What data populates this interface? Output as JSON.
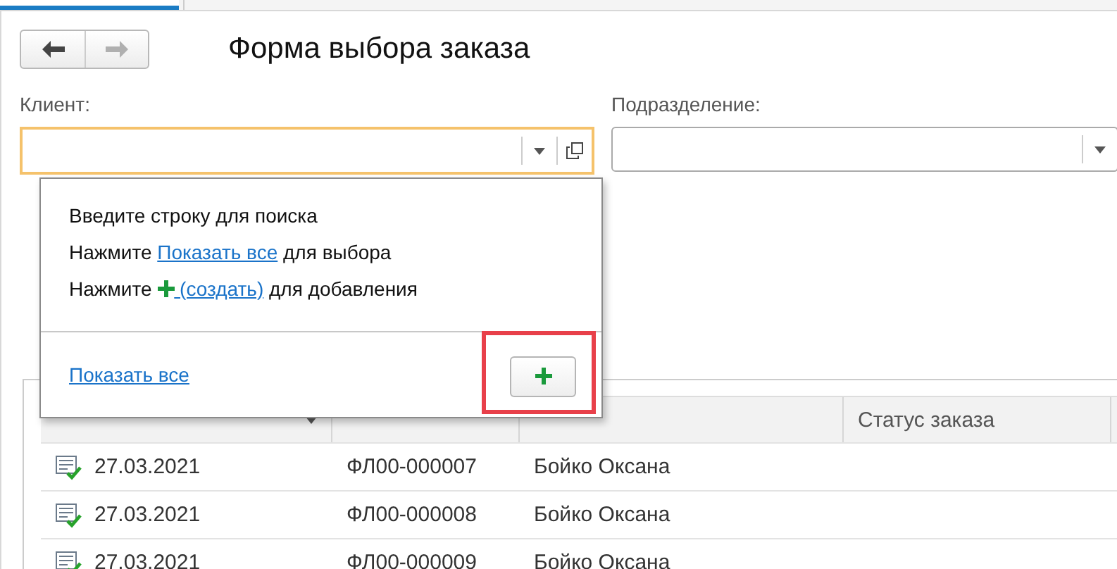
{
  "nav": {
    "back": {
      "disabled": false
    },
    "forward": {
      "disabled": true
    }
  },
  "title": "Форма выбора заказа",
  "fields": [
    {
      "label": "Клиент:",
      "focused": true,
      "open_button": true
    },
    {
      "label": "Подразделение:",
      "focused": false,
      "open_button": false
    }
  ],
  "popup": {
    "lines": [
      [
        {
          "kind": "text",
          "text": "Введите строку для поиска"
        }
      ],
      [
        {
          "kind": "text",
          "text": "Нажмите "
        },
        {
          "kind": "link",
          "text": "Показать все"
        },
        {
          "kind": "text",
          "text": " для выбора"
        }
      ],
      [
        {
          "kind": "text",
          "text": "Нажмите "
        },
        {
          "kind": "plus"
        },
        {
          "kind": "link",
          "text": " (создать)"
        },
        {
          "kind": "text",
          "text": " для добавления"
        }
      ]
    ],
    "footer_link": "Показать все",
    "add_button": {
      "highlighted": true
    }
  },
  "table": {
    "columns": [
      {
        "sorted": true
      },
      {
        "sorted": false
      },
      {
        "sorted": false
      },
      {
        "label": "Статус заказа",
        "sorted": false
      }
    ],
    "rows": [
      {
        "date": "27.03.2021",
        "number": "ФЛ00-000007",
        "client": "Бойко Оксана",
        "posted": true
      },
      {
        "date": "27.03.2021",
        "number": "ФЛ00-000008",
        "client": "Бойко Оксана",
        "posted": true
      },
      {
        "date": "27.03.2021",
        "number": "ФЛ00-000009",
        "client": "Бойко Оксана",
        "posted": true
      }
    ]
  }
}
